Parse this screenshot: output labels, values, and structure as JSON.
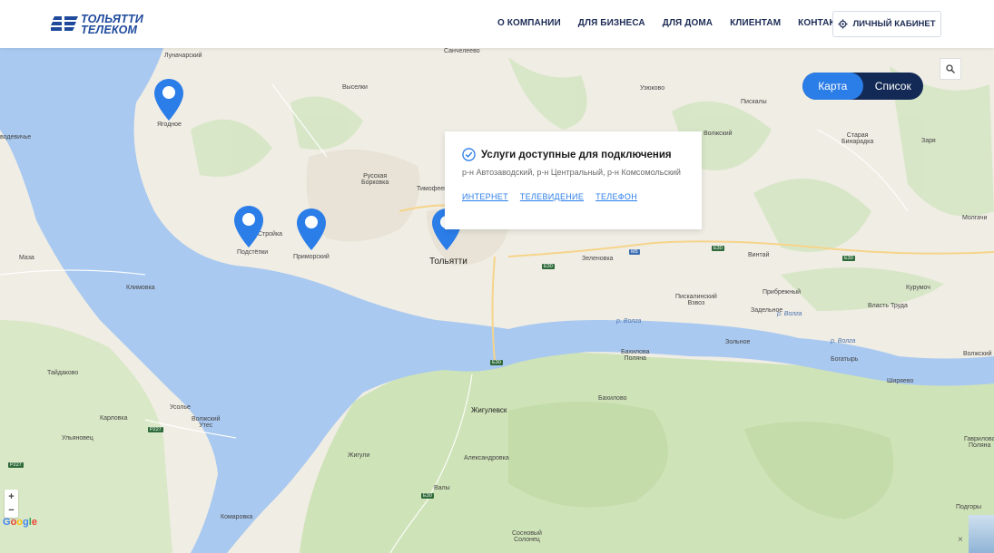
{
  "header": {
    "logo_line1": "ТОЛЬЯТТИ",
    "logo_line2": "ТЕЛЕКОМ",
    "nav": [
      "О КОМПАНИИ",
      "ДЛЯ БИЗНЕСА",
      "ДЛЯ ДОМА",
      "КЛИЕНТАМ",
      "КОНТАКТЫ"
    ],
    "cabinet_label": "ЛИЧНЫЙ КАБИНЕТ"
  },
  "view_toggle": {
    "map": "Карта",
    "list": "Список",
    "active": "map"
  },
  "popup": {
    "title": "Услуги доступные для подключения",
    "subtitle": "р-н Автозаводский, р-н Центральный, р-н Комсомольский",
    "links": [
      "ИНТЕРНЕТ",
      "ТЕЛЕВИДЕНИЕ",
      "ТЕЛЕФОН"
    ]
  },
  "map": {
    "places": {
      "lunacharsky": "Луначарский",
      "sancheleevo": "Санчелеево",
      "yagodnoe": "Ягодное",
      "vyselki": "Выселки",
      "uzyukovo": "Узюково",
      "piskaly": "Пискалы",
      "vodevichie": "водевичье",
      "russkaya_borkovka": "Русская\nБорковка",
      "timofeevka": "Тимофеевка",
      "volzhsky": "Волжский",
      "staraya_binaradka": "Старая\nБинарадка",
      "zarya": "Заря",
      "stroyka": "Стройка",
      "podstepki": "Подстёпки",
      "primorsky": "Приморский",
      "tolyatti": "Тольятти",
      "zelenovka": "Зеленовка",
      "vintay": "Винтай",
      "molgachi": "Молгачи",
      "maza": "Маза",
      "klimovka": "Климовка",
      "pribrezhny": "Прибрежный",
      "kurumoch": "Курумоч",
      "piskalinsky_vzvoz": "Пискалинский\nВзвоз",
      "zadelnoe": "Задельное",
      "vlast_truda": "Власть Труда",
      "zolnoe": "Зольное",
      "bakhilova_polyana": "Бахилова\nПоляна",
      "bogatyr": "Богатырь",
      "volzhsky2": "Волжский",
      "taydakovo": "Тайдаково",
      "bakhilovo": "Бахилово",
      "shiryaevo": "Ширяево",
      "usolye": "Усолье",
      "karlovka": "Карловка",
      "volzhsky_utes": "Волжский\nУтес",
      "zhigulevsk": "Жигулевск",
      "ulyanovets": "Ульяновец",
      "zhiguli": "Жигули",
      "aleksandrovka": "Александровка",
      "gavrilova_polyana": "Гаврилова\nПоляна",
      "valy": "Валы",
      "komarovka": "Комаровка",
      "sosnovy_solonets": "Сосновый\nСолонец",
      "podgory": "Подгоры",
      "volga1": "р. Волга",
      "volga2": "р. Волга",
      "volga3": "р. Волга"
    },
    "roads": {
      "m5": "М5",
      "e30a": "E30",
      "e30b": "E30",
      "e30c": "E30",
      "e30d": "E30",
      "e30e": "E30",
      "p227a": "P227",
      "p227b": "P227"
    }
  },
  "controls": {
    "zoom_in": "+",
    "zoom_out": "−",
    "google": "Google",
    "close": "×"
  }
}
